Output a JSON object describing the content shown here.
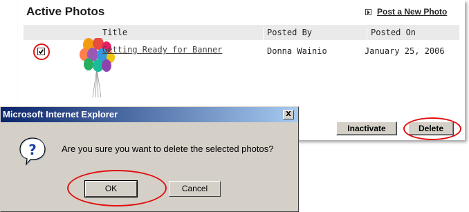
{
  "panel": {
    "title": "Active Photos",
    "post_link": "Post a New Photo",
    "columns": [
      "Title",
      "Posted By",
      "Posted On"
    ],
    "rows": [
      {
        "title": "Getting Ready for Banner",
        "posted_by": "Donna Wainio",
        "posted_on": "January 25, 2006",
        "checked": true
      }
    ],
    "buttons": {
      "inactivate": "Inactivate",
      "delete": "Delete"
    }
  },
  "dialog": {
    "title": "Microsoft Internet Explorer",
    "close": "X",
    "message": "Are you sure you want to delete the selected photos?",
    "ok": "OK",
    "cancel": "Cancel"
  },
  "colors": {
    "highlight_ring": "#e01010",
    "titlebar_start": "#0a246a",
    "titlebar_end": "#a6caf0",
    "dialog_face": "#d4d0c8"
  }
}
